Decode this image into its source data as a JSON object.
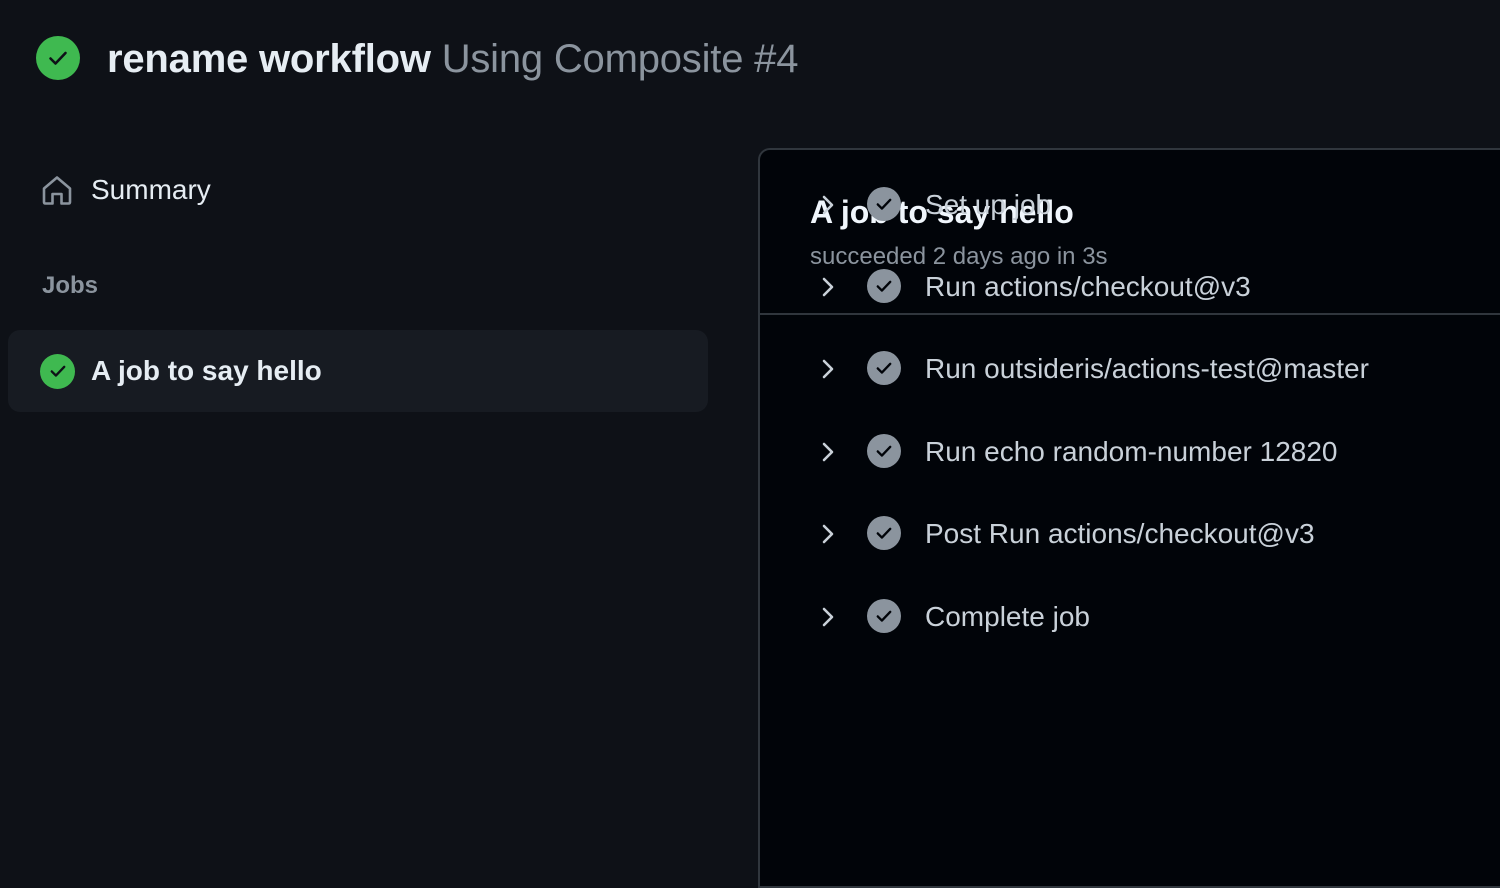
{
  "header": {
    "commit_message": "rename workflow",
    "workflow_name": "Using Composite #4",
    "status_icon": "check-circle-fill-icon",
    "status_color": "#3fb950"
  },
  "sidebar": {
    "summary_label": "Summary",
    "summary_icon": "home-icon",
    "jobs_heading": "Jobs",
    "jobs": [
      {
        "label": "A job to say hello",
        "status": "success",
        "active": true
      }
    ]
  },
  "job": {
    "title": "A job to say hello",
    "meta": "succeeded 2 days ago in 3s",
    "steps": [
      {
        "label": "Set up job",
        "status": "success"
      },
      {
        "label": "Run actions/checkout@v3",
        "status": "success"
      },
      {
        "label": "Run outsideris/actions-test@master",
        "status": "success"
      },
      {
        "label": "Run echo random-number 12820",
        "status": "success"
      },
      {
        "label": "Post Run actions/checkout@v3",
        "status": "success"
      },
      {
        "label": "Complete job",
        "status": "success"
      }
    ]
  },
  "colors": {
    "background": "#0e1117",
    "panel_background": "#010409",
    "success": "#3fb950",
    "step_check": "#8b949e",
    "muted_text": "#8b949e",
    "border": "#30363d"
  }
}
